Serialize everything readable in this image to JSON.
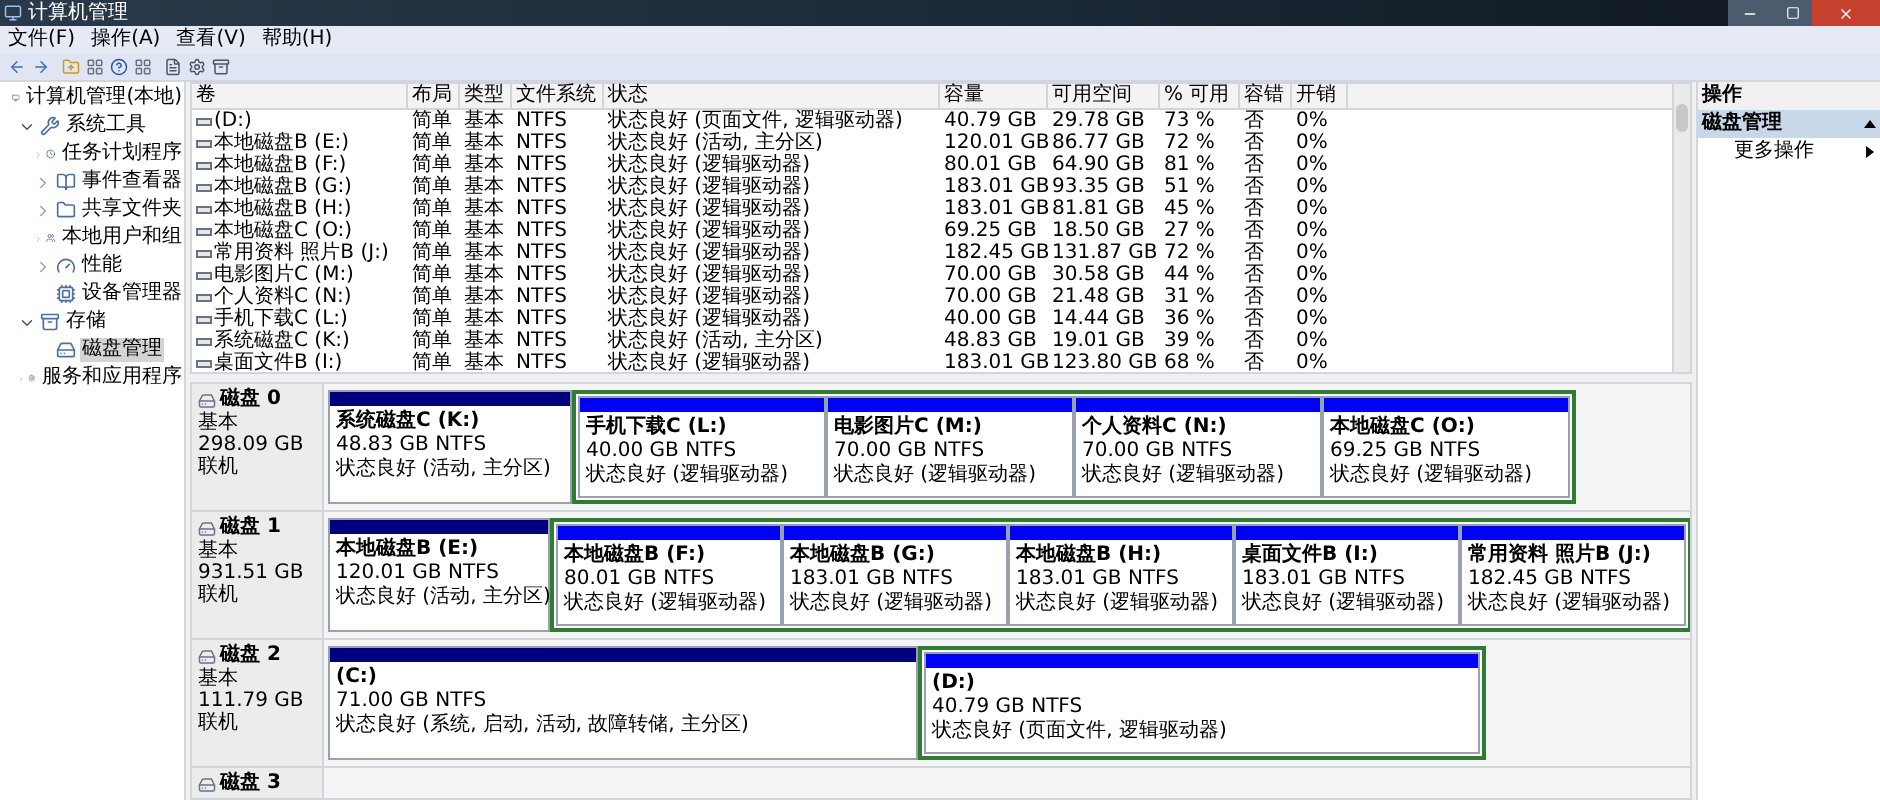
{
  "window": {
    "title": "计算机管理"
  },
  "menu": [
    "文件(F)",
    "操作(A)",
    "查看(V)",
    "帮助(H)"
  ],
  "tree": [
    {
      "label": "计算机管理(本地)",
      "selected": false,
      "children": [
        {
          "label": "系统工具",
          "selected": false,
          "expanded": true,
          "children": [
            {
              "label": "任务计划程序",
              "selected": false,
              "expanded": false
            },
            {
              "label": "事件查看器",
              "selected": false,
              "expanded": false
            },
            {
              "label": "共享文件夹",
              "selected": false,
              "expanded": false
            },
            {
              "label": "本地用户和组",
              "selected": false,
              "expanded": false
            },
            {
              "label": "性能",
              "selected": false,
              "expanded": false
            },
            {
              "label": "设备管理器",
              "selected": false
            }
          ]
        },
        {
          "label": "存储",
          "selected": false,
          "expanded": true,
          "children": [
            {
              "label": "磁盘管理",
              "selected": true
            }
          ]
        },
        {
          "label": "服务和应用程序",
          "selected": false,
          "expanded": false
        }
      ]
    }
  ],
  "table": {
    "columns": [
      "卷",
      "布局",
      "类型",
      "文件系统",
      "状态",
      "容量",
      "可用空间",
      "% 可用",
      "容错",
      "开销"
    ],
    "rows": [
      [
        "(D:)",
        "简单",
        "基本",
        "NTFS",
        "状态良好 (页面文件, 逻辑驱动器)",
        "40.79 GB",
        "29.78 GB",
        "73 %",
        "否",
        "0%"
      ],
      [
        "本地磁盘B (E:)",
        "简单",
        "基本",
        "NTFS",
        "状态良好 (活动, 主分区)",
        "120.01 GB",
        "86.77 GB",
        "72 %",
        "否",
        "0%"
      ],
      [
        "本地磁盘B (F:)",
        "简单",
        "基本",
        "NTFS",
        "状态良好 (逻辑驱动器)",
        "80.01 GB",
        "64.90 GB",
        "81 %",
        "否",
        "0%"
      ],
      [
        "本地磁盘B (G:)",
        "简单",
        "基本",
        "NTFS",
        "状态良好 (逻辑驱动器)",
        "183.01 GB",
        "93.35 GB",
        "51 %",
        "否",
        "0%"
      ],
      [
        "本地磁盘B (H:)",
        "简单",
        "基本",
        "NTFS",
        "状态良好 (逻辑驱动器)",
        "183.01 GB",
        "81.81 GB",
        "45 %",
        "否",
        "0%"
      ],
      [
        "本地磁盘C (O:)",
        "简单",
        "基本",
        "NTFS",
        "状态良好 (逻辑驱动器)",
        "69.25 GB",
        "18.50 GB",
        "27 %",
        "否",
        "0%"
      ],
      [
        "常用资料 照片B (J:)",
        "简单",
        "基本",
        "NTFS",
        "状态良好 (逻辑驱动器)",
        "182.45 GB",
        "131.87 GB",
        "72 %",
        "否",
        "0%"
      ],
      [
        "电影图片C (M:)",
        "简单",
        "基本",
        "NTFS",
        "状态良好 (逻辑驱动器)",
        "70.00 GB",
        "30.58 GB",
        "44 %",
        "否",
        "0%"
      ],
      [
        "个人资料C (N:)",
        "简单",
        "基本",
        "NTFS",
        "状态良好 (逻辑驱动器)",
        "70.00 GB",
        "21.48 GB",
        "31 %",
        "否",
        "0%"
      ],
      [
        "手机下载C (L:)",
        "简单",
        "基本",
        "NTFS",
        "状态良好 (逻辑驱动器)",
        "40.00 GB",
        "14.44 GB",
        "36 %",
        "否",
        "0%"
      ],
      [
        "系统磁盘C (K:)",
        "简单",
        "基本",
        "NTFS",
        "状态良好 (活动, 主分区)",
        "48.83 GB",
        "19.01 GB",
        "39 %",
        "否",
        "0%"
      ],
      [
        "桌面文件B (I:)",
        "简单",
        "基本",
        "NTFS",
        "状态良好 (逻辑驱动器)",
        "183.01 GB",
        "123.80 GB",
        "68 %",
        "否",
        "0%"
      ]
    ]
  },
  "disks": [
    {
      "label": "磁盘 0",
      "type": "基本",
      "size": "298.09 GB",
      "status": "联机",
      "partitions": [
        {
          "kind": "primary",
          "name": "系统磁盘C  (K:)",
          "size": "48.83 GB NTFS",
          "status": "状态良好 (活动, 主分区)"
        },
        {
          "kind": "logical",
          "name": "手机下载C  (L:)",
          "size": "40.00 GB NTFS",
          "status": "状态良好 (逻辑驱动器)"
        },
        {
          "kind": "logical",
          "name": "电影图片C  (M:)",
          "size": "70.00 GB NTFS",
          "status": "状态良好 (逻辑驱动器)"
        },
        {
          "kind": "logical",
          "name": "个人资料C  (N:)",
          "size": "70.00 GB NTFS",
          "status": "状态良好 (逻辑驱动器)"
        },
        {
          "kind": "logical",
          "name": "本地磁盘C  (O:)",
          "size": "69.25 GB NTFS",
          "status": "状态良好 (逻辑驱动器)"
        }
      ]
    },
    {
      "label": "磁盘 1",
      "type": "基本",
      "size": "931.51 GB",
      "status": "联机",
      "partitions": [
        {
          "kind": "primary",
          "name": "本地磁盘B  (E:)",
          "size": "120.01 GB NTFS",
          "status": "状态良好 (活动, 主分区)"
        },
        {
          "kind": "logical",
          "name": "本地磁盘B  (F:)",
          "size": "80.01 GB NTFS",
          "status": "状态良好 (逻辑驱动器)"
        },
        {
          "kind": "logical",
          "name": "本地磁盘B  (G:)",
          "size": "183.01 GB NTFS",
          "status": "状态良好 (逻辑驱动器)"
        },
        {
          "kind": "logical",
          "name": "本地磁盘B  (H:)",
          "size": "183.01 GB NTFS",
          "status": "状态良好 (逻辑驱动器)"
        },
        {
          "kind": "logical",
          "name": "桌面文件B  (I:)",
          "size": "183.01 GB NTFS",
          "status": "状态良好 (逻辑驱动器)"
        },
        {
          "kind": "logical",
          "name": "常用资料 照片B  (J:)",
          "size": "182.45 GB NTFS",
          "status": "状态良好 (逻辑驱动器)"
        }
      ]
    },
    {
      "label": "磁盘 2",
      "type": "基本",
      "size": "111.79 GB",
      "status": "联机",
      "partitions": [
        {
          "kind": "primary",
          "name": "(C:)",
          "size": "71.00 GB NTFS",
          "status": "状态良好 (系统, 启动, 活动, 故障转储, 主分区)"
        },
        {
          "kind": "logical",
          "name": "(D:)",
          "size": "40.79 GB NTFS",
          "status": "状态良好 (页面文件, 逻辑驱动器)"
        }
      ]
    },
    {
      "label": "磁盘 3"
    }
  ],
  "actions": {
    "title": "操作",
    "section": "磁盘管理",
    "items": [
      "更多操作"
    ]
  }
}
